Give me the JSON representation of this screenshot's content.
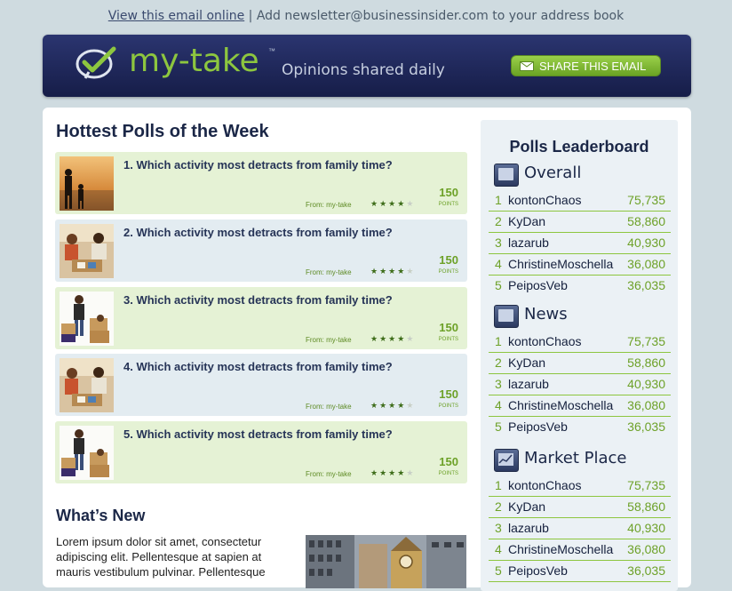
{
  "topline": {
    "view_link": "View this email online",
    "separator": " | ",
    "add_text": "Add newsletter@businessinsider.com to your address book"
  },
  "header": {
    "logo_text": "my-take",
    "logo_tm": "™",
    "tagline": "Opinions shared daily",
    "share_label": "SHARE THIS EMAIL",
    "brand_green": "#8dc63f",
    "banner_navy": "#1e2756"
  },
  "polls": {
    "heading": "Hottest Polls of the Week",
    "items": [
      {
        "question": "1. Which activity most detracts from family time?",
        "from": "From: my-take",
        "points": "150",
        "points_label": "POINTS",
        "rating": 4,
        "rating_max": 5,
        "thumb": "family-beach-photo"
      },
      {
        "question": "2. Which activity most detracts from family time?",
        "from": "From: my-take",
        "points": "150",
        "points_label": "POINTS",
        "rating": 4,
        "rating_max": 5,
        "thumb": "family-boardgame-photo"
      },
      {
        "question": "3. Which activity most detracts from family time?",
        "from": "From: my-take",
        "points": "150",
        "points_label": "POINTS",
        "rating": 4,
        "rating_max": 5,
        "thumb": "family-moving-boxes-photo"
      },
      {
        "question": "4. Which activity most detracts from family time?",
        "from": "From: my-take",
        "points": "150",
        "points_label": "POINTS",
        "rating": 4,
        "rating_max": 5,
        "thumb": "family-boardgame-photo"
      },
      {
        "question": "5. Which activity most detracts from family time?",
        "from": "From: my-take",
        "points": "150",
        "points_label": "POINTS",
        "rating": 4,
        "rating_max": 5,
        "thumb": "family-moving-boxes-photo"
      }
    ]
  },
  "whats_new": {
    "heading": "What’s New",
    "body": "Lorem ipsum dolor sit amet, consectetur adipiscing elit. Pellentesque at sapien at mauris vestibulum pulvinar. Pellentesque",
    "image": "city-clock-tower-photo"
  },
  "leaderboard": {
    "title": "Polls Leaderboard",
    "sections": [
      {
        "name": "Overall",
        "icon": "news-icon",
        "rows": [
          {
            "rank": "1",
            "name": "kontonChaos",
            "score": "75,735"
          },
          {
            "rank": "2",
            "name": "KyDan",
            "score": "58,860"
          },
          {
            "rank": "3",
            "name": "lazarub",
            "score": "40,930"
          },
          {
            "rank": "4",
            "name": "ChristineMoschella",
            "score": "36,080"
          },
          {
            "rank": "5",
            "name": "PeiposVeb",
            "score": "36,035"
          }
        ]
      },
      {
        "name": "News",
        "icon": "news-icon",
        "rows": [
          {
            "rank": "1",
            "name": "kontonChaos",
            "score": "75,735"
          },
          {
            "rank": "2",
            "name": "KyDan",
            "score": "58,860"
          },
          {
            "rank": "3",
            "name": "lazarub",
            "score": "40,930"
          },
          {
            "rank": "4",
            "name": "ChristineMoschella",
            "score": "36,080"
          },
          {
            "rank": "5",
            "name": "PeiposVeb",
            "score": "36,035"
          }
        ]
      },
      {
        "name": "Market Place",
        "icon": "market-chart-icon",
        "rows": [
          {
            "rank": "1",
            "name": "kontonChaos",
            "score": "75,735"
          },
          {
            "rank": "2",
            "name": "KyDan",
            "score": "58,860"
          },
          {
            "rank": "3",
            "name": "lazarub",
            "score": "40,930"
          },
          {
            "rank": "4",
            "name": "ChristineMoschella",
            "score": "36,080"
          },
          {
            "rank": "5",
            "name": "PeiposVeb",
            "score": "36,035"
          }
        ]
      }
    ]
  }
}
